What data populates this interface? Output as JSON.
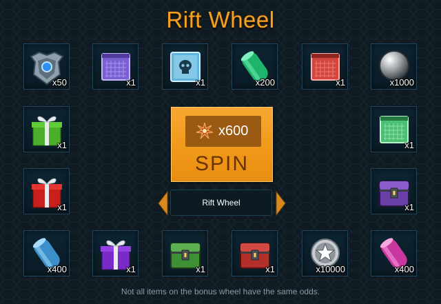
{
  "title": "Rift Wheel",
  "spin_button": {
    "cost": "x600",
    "label": "SPIN",
    "cost_icon": "rift-core-icon"
  },
  "wheel_selector": {
    "name": "Rift Wheel"
  },
  "footer_note": "Not all items on the bonus wheel have the same odds.",
  "rewards": [
    {
      "icon": "shield-emblem-icon",
      "qty": "x50"
    },
    {
      "icon": "purple-tech-card-icon",
      "qty": "x1"
    },
    {
      "icon": "skull-chip-icon",
      "qty": "x1"
    },
    {
      "icon": "green-canister-icon",
      "qty": "x200"
    },
    {
      "icon": "red-tech-card-icon",
      "qty": "x1"
    },
    {
      "icon": "silver-orb-icon",
      "qty": "x1000"
    },
    {
      "icon": "green-gift-icon",
      "qty": "x1"
    },
    {
      "icon": "green-tech-card-icon",
      "qty": "x1"
    },
    {
      "icon": "red-gift-icon",
      "qty": "x1"
    },
    {
      "icon": "purple-crate-icon",
      "qty": "x1"
    },
    {
      "icon": "blue-canister-icon",
      "qty": "x400"
    },
    {
      "icon": "purple-gift-icon",
      "qty": "x1"
    },
    {
      "icon": "green-crate-icon",
      "qty": "x1"
    },
    {
      "icon": "red-crate-icon",
      "qty": "x1"
    },
    {
      "icon": "silver-star-badge-icon",
      "qty": "x10000"
    },
    {
      "icon": "pink-canister-icon",
      "qty": "x400"
    }
  ]
}
